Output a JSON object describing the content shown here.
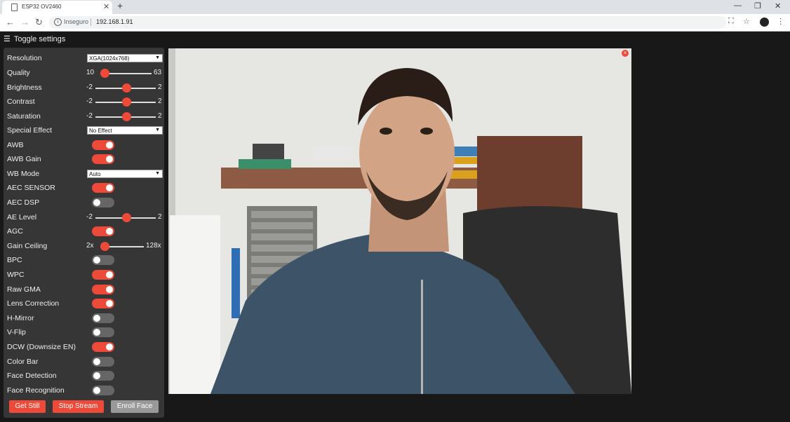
{
  "browser": {
    "tab_title": "ESP32 OV2460",
    "security": "Inseguro",
    "url": "192.168.1.91"
  },
  "page": {
    "toggle_settings": "Toggle settings"
  },
  "settings": {
    "resolution": {
      "label": "Resolution",
      "value": "XGA(1024x768)"
    },
    "quality": {
      "label": "Quality",
      "min": "10",
      "max": "63",
      "value": 10
    },
    "brightness": {
      "label": "Brightness",
      "min": "-2",
      "max": "2",
      "value": 0
    },
    "contrast": {
      "label": "Contrast",
      "min": "-2",
      "max": "2",
      "value": 0
    },
    "saturation": {
      "label": "Saturation",
      "min": "-2",
      "max": "2",
      "value": 0
    },
    "special_effect": {
      "label": "Special Effect",
      "value": "No Effect"
    },
    "awb": {
      "label": "AWB",
      "on": true
    },
    "awb_gain": {
      "label": "AWB Gain",
      "on": true
    },
    "wb_mode": {
      "label": "WB Mode",
      "value": "Auto"
    },
    "aec_sensor": {
      "label": "AEC SENSOR",
      "on": true
    },
    "aec_dsp": {
      "label": "AEC DSP",
      "on": false
    },
    "ae_level": {
      "label": "AE Level",
      "min": "-2",
      "max": "2",
      "value": 0
    },
    "agc": {
      "label": "AGC",
      "on": true
    },
    "gain_ceiling": {
      "label": "Gain Ceiling",
      "min": "2x",
      "max": "128x",
      "value": 0
    },
    "bpc": {
      "label": "BPC",
      "on": false
    },
    "wpc": {
      "label": "WPC",
      "on": true
    },
    "raw_gma": {
      "label": "Raw GMA",
      "on": true
    },
    "lens_correction": {
      "label": "Lens Correction",
      "on": true
    },
    "h_mirror": {
      "label": "H-Mirror",
      "on": false
    },
    "v_flip": {
      "label": "V-Flip",
      "on": false
    },
    "dcw": {
      "label": "DCW (Downsize EN)",
      "on": true
    },
    "color_bar": {
      "label": "Color Bar",
      "on": false
    },
    "face_detection": {
      "label": "Face Detection",
      "on": false
    },
    "face_recognition": {
      "label": "Face Recognition",
      "on": false
    }
  },
  "buttons": {
    "get_still": "Get Still",
    "stop_stream": "Stop Stream",
    "enroll_face": "Enroll Face"
  },
  "colors": {
    "accent": "#ee4a3a",
    "panel": "#363636",
    "background": "#181818"
  }
}
